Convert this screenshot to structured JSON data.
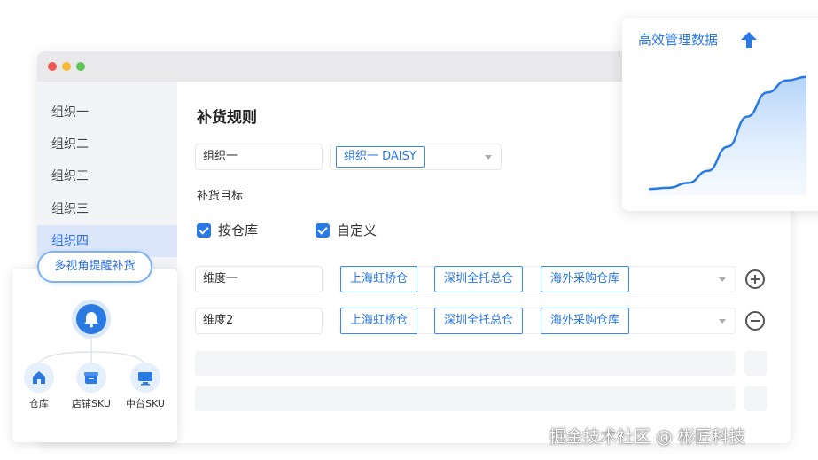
{
  "sidebar": {
    "items": [
      {
        "label": "组织一"
      },
      {
        "label": "组织二"
      },
      {
        "label": "组织三"
      },
      {
        "label": "组织三"
      },
      {
        "label": "组织四",
        "active": true
      }
    ]
  },
  "main": {
    "title": "补货规则",
    "org_field": {
      "value": "组织一"
    },
    "org_select": {
      "selected_tag": "组织一 DAISY"
    },
    "target_label": "补货目标",
    "checkboxes": [
      {
        "label": "按仓库",
        "checked": true
      },
      {
        "label": "自定义",
        "checked": true
      }
    ],
    "dimensions": [
      {
        "name": "维度一",
        "tags": [
          "上海虹桥仓",
          "深圳全托总仓",
          "海外采购仓库"
        ],
        "action_icon": "plus-circle-icon"
      },
      {
        "name": "维度2",
        "tags": [
          "上海虹桥仓",
          "深圳全托总仓",
          "海外采购仓库"
        ],
        "action_icon": "minus-circle-icon"
      }
    ]
  },
  "chart_card": {
    "title": "高效管理数据",
    "icon": "arrow-up-icon",
    "accent": "#2a78e4"
  },
  "chart_data": {
    "type": "area",
    "title": "高效管理数据",
    "xlabel": "",
    "ylabel": "",
    "x": [
      0,
      1,
      2,
      3,
      4,
      5,
      6,
      7,
      8
    ],
    "series": [
      {
        "values": [
          0.05,
          0.06,
          0.1,
          0.2,
          0.4,
          0.65,
          0.85,
          0.95,
          0.98
        ]
      }
    ],
    "ylim": [
      0,
      1
    ],
    "grid": false,
    "legend": "none"
  },
  "feature_card": {
    "pill_label": "多视角提醒补货",
    "center_icon": "bell-icon",
    "items": [
      {
        "label": "仓库",
        "icon": "warehouse-icon"
      },
      {
        "label": "店铺SKU",
        "icon": "store-icon"
      },
      {
        "label": "中台SKU",
        "icon": "monitor-icon"
      }
    ]
  },
  "watermark": "掘金技术社区 @ 彬匠科技",
  "colors": {
    "accent": "#2a78e4",
    "sidebar_bg": "#f3f4f7",
    "active_bg": "#dce6fb"
  }
}
